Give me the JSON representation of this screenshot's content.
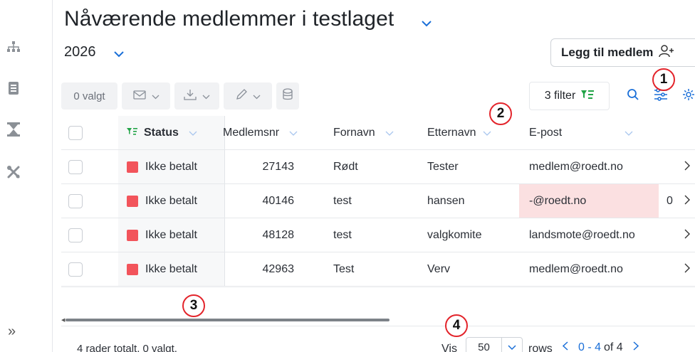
{
  "sidebar": {
    "icons": [
      "org-chart-icon",
      "contacts-book-icon",
      "hourglass-icon",
      "tools-icon"
    ],
    "expand_label": "»"
  },
  "header": {
    "title": "Nåværende medlemmer i testlaget",
    "year": "2026",
    "add_member_label": "Legg til medlem"
  },
  "toolbar": {
    "selected_label": "0 valgt",
    "filter_label": "3 filter"
  },
  "table": {
    "columns": [
      {
        "label": "Status"
      },
      {
        "label": "Medlemsnr"
      },
      {
        "label": "Fornavn"
      },
      {
        "label": "Etternavn"
      },
      {
        "label": "E-post"
      }
    ],
    "rows": [
      {
        "status": "Ikke betalt",
        "nr": "27143",
        "fornavn": "Rødt",
        "etternavn": "Tester",
        "epost": "medlem@roedt.no",
        "extra": "",
        "email_invalid": false
      },
      {
        "status": "Ikke betalt",
        "nr": "40146",
        "fornavn": "test",
        "etternavn": "hansen",
        "epost": "-@roedt.no",
        "extra": "0",
        "email_invalid": true
      },
      {
        "status": "Ikke betalt",
        "nr": "48128",
        "fornavn": "test",
        "etternavn": "valgkomite",
        "epost": "landsmote@roedt.no",
        "extra": "",
        "email_invalid": false
      },
      {
        "status": "Ikke betalt",
        "nr": "42963",
        "fornavn": "Test",
        "etternavn": "Verv",
        "epost": "medlem@roedt.no",
        "extra": "",
        "email_invalid": false
      }
    ]
  },
  "footer": {
    "total_text": "4 rader totalt, 0 valgt.",
    "vis_label": "Vis",
    "rows_per_page": "50",
    "rows_label": "rows",
    "page_range": "0 - 4",
    "page_of": "of 4"
  },
  "callouts": [
    "1",
    "2",
    "3",
    "4"
  ],
  "colors": {
    "accent": "#1a6fd8",
    "status_unpaid": "#f2545b",
    "filter_green": "#22a447",
    "invalid_email_bg": "#fbe0e1",
    "callout_ring": "#e3242b"
  }
}
